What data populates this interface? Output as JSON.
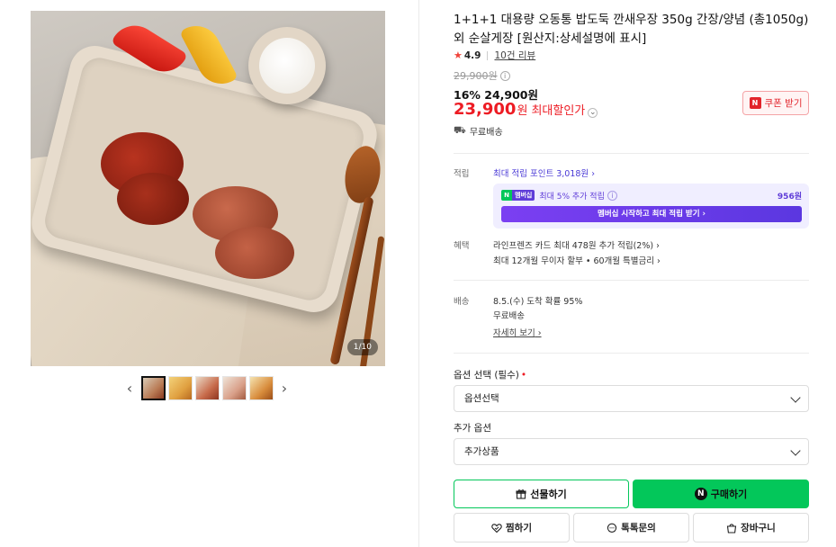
{
  "gallery": {
    "counter": "1/10",
    "thumbnails": [
      {
        "active": true,
        "color": "#b97b55"
      },
      {
        "active": false,
        "color": "#e0a040"
      },
      {
        "active": false,
        "color": "#c76a4a"
      },
      {
        "active": false,
        "color": "#d9a089"
      },
      {
        "active": false,
        "color": "#d88c3c"
      }
    ]
  },
  "product": {
    "title": "1+1+1 대용량 오동통 밥도둑 깐새우장 350g 간장/양념 (총1050g)외 순살게장 [원산지:상세설명에 표시]",
    "rating": "4.9",
    "review_link": "10건 리뷰",
    "original_price": "29,900원",
    "sale_price": "16% 24,900원",
    "max_price": "23,900",
    "max_unit": "원",
    "max_label": "최대할인가",
    "coupon_label": "쿠폰 받기",
    "shipping": "무료배송"
  },
  "points": {
    "label": "적립",
    "link": "최대 적립 포인트 3,018원",
    "membership_badge": "멤버십",
    "extra_text": "최대 5% 추가 적립",
    "extra_amount": "956원",
    "membership_cta": "멤버십 시작하고 최대 적립 받기"
  },
  "benefits": {
    "label": "혜택",
    "lines": [
      "라인프렌즈 카드 최대 478원 추가 적립(2%)",
      "최대 12개월 무이자 할부 • 60개월 특별금리"
    ]
  },
  "delivery": {
    "label": "배송",
    "arrival": "8.5.(수) 도착 확률 95%",
    "fee": "무료배송",
    "detail_link": "자세히 보기"
  },
  "options": {
    "required_label": "옵션 선택 (필수)",
    "required_mark": "•",
    "required_value": "옵션선택",
    "extra_label": "추가 옵션",
    "extra_value": "추가상품"
  },
  "actions": {
    "gift": "선물하기",
    "buy": "구매하기",
    "wish": "찜하기",
    "talk": "톡톡문의",
    "cart": "장바구니"
  },
  "colors": {
    "accent_green": "#03c75a",
    "price_red": "#ed1c24",
    "membership_purple": "#5f3dd8"
  }
}
